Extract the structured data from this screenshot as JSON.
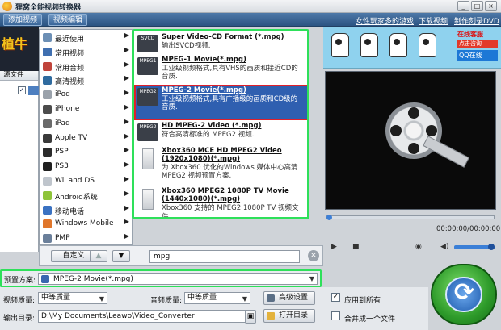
{
  "app": {
    "title": "狸窝全能视频转换器",
    "window_controls": [
      "_",
      "□",
      "×"
    ]
  },
  "toolbar": {
    "add_video": "添加视频",
    "video_edit": "视频编辑",
    "links": [
      "女性玩家多的游戏",
      "下载视频",
      "制作刻录DVD"
    ]
  },
  "left": {
    "ad_text": "植牛",
    "source_header": "源文件",
    "row_checked": true
  },
  "categories": [
    {
      "label": "最近使用",
      "icon": "clock-icon",
      "color": "#6c8fb5"
    },
    {
      "label": "常用视频",
      "icon": "video-icon",
      "color": "#3f6fb0"
    },
    {
      "label": "常用音频",
      "icon": "audio-icon",
      "color": "#c0443b"
    },
    {
      "label": "高清视频",
      "icon": "hd-icon",
      "color": "#2f6b9f"
    },
    {
      "label": "iPod",
      "icon": "ipod-icon",
      "color": "#9aa2ab"
    },
    {
      "label": "iPhone",
      "icon": "iphone-icon",
      "color": "#4c4c4c"
    },
    {
      "label": "iPad",
      "icon": "ipad-icon",
      "color": "#6a6a6a"
    },
    {
      "label": "Apple TV",
      "icon": "appletv-icon",
      "color": "#3a3a3a"
    },
    {
      "label": "PSP",
      "icon": "psp-icon",
      "color": "#2b2b2b"
    },
    {
      "label": "PS3",
      "icon": "ps3-icon",
      "color": "#202020"
    },
    {
      "label": "Wii and DS",
      "icon": "wii-icon",
      "color": "#bfc5cc"
    },
    {
      "label": "Android系统",
      "icon": "android-icon",
      "color": "#8fc43a"
    },
    {
      "label": "移动电话",
      "icon": "phone-icon",
      "color": "#3a72c2"
    },
    {
      "label": "Windows Mobile",
      "icon": "windows-icon",
      "color": "#e0762b"
    },
    {
      "label": "PMP",
      "icon": "pmp-icon",
      "color": "#6a7f9a"
    }
  ],
  "formats": [
    {
      "name": "Super Video-CD Format (*.mpg)",
      "desc": [
        "输出SVCD视频."
      ],
      "thumb": "SVCD",
      "selected": false
    },
    {
      "name": "MPEG-1 Movie(*.mpg)",
      "desc": [
        "工业级视频格式,具有VHS的画质和接近CD的",
        "音质."
      ],
      "thumb": "MPEG1",
      "selected": false
    },
    {
      "name": "MPEG-2 Movie(*.mpg)",
      "desc": [
        "工业级视频格式,具有广播级的画质和CD级的",
        "音质."
      ],
      "thumb": "MPEG2",
      "selected": true
    },
    {
      "name": "HD MPEG-2 Video (*.mpg)",
      "desc": [
        "符合高清标准的 MPEG2 视频."
      ],
      "thumb": "MPEG2",
      "selected": false
    },
    {
      "name": "Xbox360 MCE HD MPEG2 Video",
      "name2": "(1920x1080)(*.mpg)",
      "desc": [
        "为 Xbox360 优化的Windows 媒体中心高清",
        "MPEG2 视频预置方案."
      ],
      "thumb": "xbox",
      "selected": false
    },
    {
      "name": "Xbox360 MPEG2 1080P TV Movie",
      "name2": "(1440x1080)(*.mpg)",
      "desc": [
        "Xbox360 支持的 MPEG2 1080P TV 视频文件."
      ],
      "thumb": "xbox",
      "selected": false
    }
  ],
  "menu_bottom": {
    "custom_label": "自定义",
    "search_value": "mpg"
  },
  "ad_banner": {
    "online": "在线客服",
    "click": "点击咨询",
    "qq": "QQ在线"
  },
  "player": {
    "progress": 0.0,
    "timecode": "00:00:00/00:00:00",
    "volume": 1.0
  },
  "preset": {
    "label": "预置方案:",
    "value": "MPEG-2 Movie(*.mpg)"
  },
  "settings": {
    "video_quality_label": "视频质量:",
    "video_quality_value": "中等质量",
    "audio_quality_label": "音频质量:",
    "audio_quality_value": "中等质量",
    "advanced_button": "高级设置",
    "apply_all_label": "应用到所有",
    "apply_all_checked": true,
    "output_dir_label": "输出目录:",
    "output_dir_value": "D:\\My Documents\\Leawo\\Video_Converter",
    "open_dir_button": "打开目录",
    "merge_label": "合并成一个文件",
    "merge_checked": false
  },
  "colors": {
    "highlight_border": "#2ee05a",
    "selected_bg": "#2f5fb0",
    "selected_border": "#e0202a",
    "toolbar_bg": "#2c5482"
  }
}
